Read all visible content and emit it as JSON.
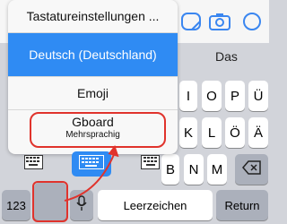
{
  "app": {
    "accent_color": "#2f8bf3",
    "annotation_color": "#e0332c"
  },
  "suggestion_bar": {
    "word": "Das"
  },
  "keyboard_popup": {
    "settings_label": "Tastatureinstellungen ...",
    "items": [
      {
        "label": "Deutsch (Deutschland)",
        "selected": true
      },
      {
        "label": "Emoji"
      },
      {
        "label": "Gboard",
        "sublabel": "Mehrsprachig"
      }
    ],
    "layout_icons": [
      "keyboard-left-icon",
      "keyboard-full-icon",
      "keyboard-right-icon"
    ],
    "active_layout_index": 1
  },
  "keys": {
    "row1": [
      "I",
      "O",
      "P",
      "Ü"
    ],
    "row2": [
      "K",
      "L",
      "Ö",
      "Ä"
    ],
    "row3": [
      "B",
      "N",
      "M"
    ],
    "numbers_label": "123",
    "space_label": "Leerzeichen",
    "return_label": "Return"
  }
}
